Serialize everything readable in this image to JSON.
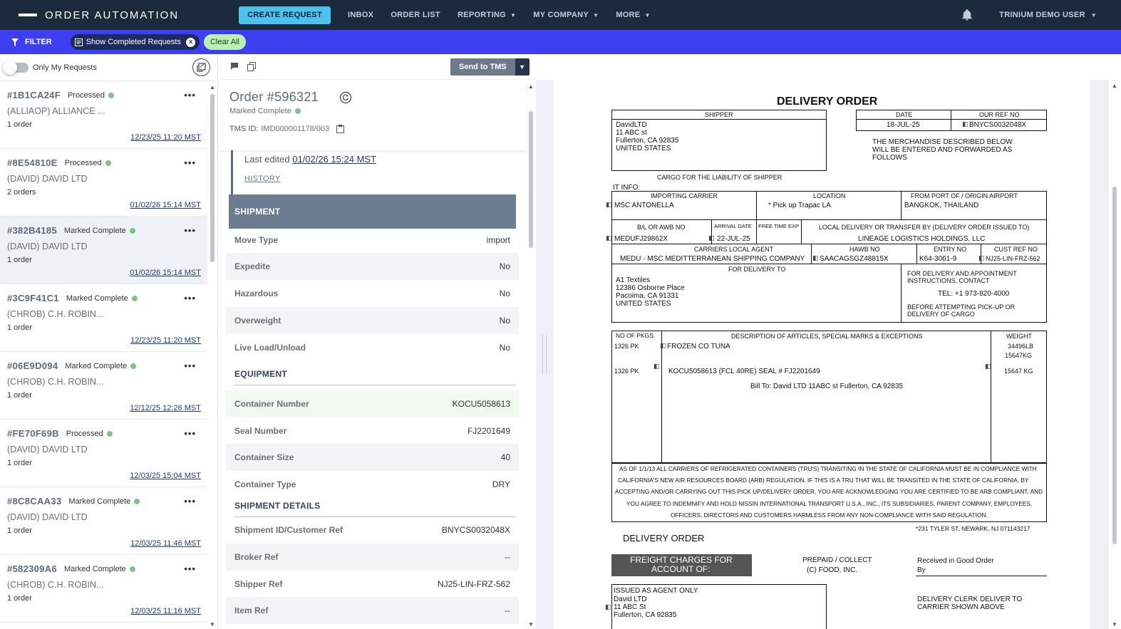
{
  "nav": {
    "logo_text": "ORDER AUTOMATION",
    "create_request": "CREATE REQUEST",
    "inbox": "INBOX",
    "order_list": "ORDER LIST",
    "reporting": "REPORTING",
    "my_company": "MY COMPANY",
    "more": "MORE",
    "user": "TRINIUM DEMO USER"
  },
  "filterbar": {
    "filter_label": "FILTER",
    "chip_label": "Show Completed Requests",
    "clear_all": "Clear All"
  },
  "sidebar": {
    "toggle_label": "Only My Requests",
    "requests": [
      {
        "id": "#1B1CA24F",
        "status": "Processed",
        "name": "(ALLIAOP) ALLIANCE ...",
        "count": "1 order",
        "date": "12/23/25 11:20 MST"
      },
      {
        "id": "#8E54810E",
        "status": "Processed",
        "name": "(DAVID) DAVID LTD",
        "count": "2 orders",
        "date": "01/02/26 15:14 MST"
      },
      {
        "id": "#382B4185",
        "status": "Marked Complete",
        "name": "(DAVID) DAVID LTD",
        "count": "1 order",
        "date": "01/02/26 15:14 MST"
      },
      {
        "id": "#3C9F41C1",
        "status": "Marked Complete",
        "name": "(CHROB) C.H. ROBIN...",
        "count": "1 order",
        "date": "12/23/25 11:20 MST"
      },
      {
        "id": "#06E9D094",
        "status": "Marked Complete",
        "name": "(CHROB) C.H. ROBIN...",
        "count": "1 order",
        "date": "12/12/25 12:26 MST"
      },
      {
        "id": "#FE70F69B",
        "status": "Processed",
        "name": "(DAVID) DAVID LTD",
        "count": "1 order",
        "date": "12/03/25 15:04 MST"
      },
      {
        "id": "#8C8CAA33",
        "status": "Marked Complete",
        "name": "(DAVID) DAVID LTD",
        "count": "1 order",
        "date": "12/03/25 11:46 MST"
      },
      {
        "id": "#582309A6",
        "status": "Marked Complete",
        "name": "(CHROB) C.H. ROBIN...",
        "count": "1 order",
        "date": "12/03/25 11:16 MST"
      }
    ]
  },
  "order": {
    "send_to_tms": "Send to TMS",
    "title": "Order #596321",
    "status": "Marked Complete",
    "tms_label": "TMS ID:",
    "tms_value": "IMD000001178/003",
    "last_edited_label": "Last edited",
    "last_edited_value": "01/02/26 15:24 MST",
    "history": "HISTORY",
    "shipment_header": "SHIPMENT",
    "shipment_rows": [
      {
        "k": "Move Type",
        "v": "import"
      },
      {
        "k": "Expedite",
        "v": "No"
      },
      {
        "k": "Hazardous",
        "v": "No"
      },
      {
        "k": "Overweight",
        "v": "No"
      },
      {
        "k": "Live Load/Unload",
        "v": "No"
      }
    ],
    "equipment_header": "EQUIPMENT",
    "equipment_rows": [
      {
        "k": "Container Number",
        "v": "KOCU5058613"
      },
      {
        "k": "Seal Number",
        "v": "FJ2201649"
      },
      {
        "k": "Container Size",
        "v": "40"
      },
      {
        "k": "Container Type",
        "v": "DRY"
      }
    ],
    "details_header": "SHIPMENT DETAILS",
    "details_rows": [
      {
        "k": "Shipment ID/Customer Ref",
        "v": "BNYCS0032048X"
      },
      {
        "k": "Broker Ref",
        "v": "--"
      },
      {
        "k": "Shipper Ref",
        "v": "NJ25-LIN-FRZ-562"
      },
      {
        "k": "Item Ref",
        "v": "--"
      }
    ]
  },
  "doc": {
    "title": "DELIVERY ORDER",
    "shipper_label": "SHIPPER",
    "shipper_lines": [
      "DavidLTD",
      "11 ABC st",
      "Fullerton, CA 92835",
      "UNITED STATES"
    ],
    "date_label": "DATE",
    "date_value": "18-JUL-25",
    "ourref_label": "OUR REF NO",
    "ourref_value": "BNYCS0032048X",
    "merch_lines": [
      "THE MERCHANDISE DESCRIBED BELOW",
      "WILL BE ENTERED AND FORWARDED AS",
      "FOLLOWS"
    ],
    "cargo_liability": "CARGO FOR THE LIABILITY OF SHIPPER",
    "it_info": "IT INFO:",
    "importing_carrier_label": "IMPORTING CARRIER",
    "importing_carrier_value": "MSC ANTONELLA",
    "location_label": "LOCATION",
    "location_value": "* Pick up  Trapac LA",
    "origin_label": "FROM PORT OF / ORIGIN AIRPORT",
    "origin_value": "BANGKOK, THAILAND",
    "bl_label": "B/L OR AWB NO",
    "bl_value": "MEDUFJ29862X",
    "arrival_label": "ARRIVAL DATE",
    "arrival_value": "22-JUL-25",
    "freetime_label": "FREE TIME EXP",
    "local_delivery_label": "LOCAL DELIVERY OR TRANSFER BY (DELIVERY ORDER ISSUED TO)",
    "local_delivery_value": "LINEAGE LOGISTICS HOLDINGS, LLC",
    "carriers_agent_label": "CARRIERS LOCAL AGENT",
    "carriers_agent_value": "MEDU - MSC MEDITTERRANEAN SHIPPING COMPANY",
    "hawb_label": "HAWB NO",
    "hawb_value": "SAACAGSGZ48815X",
    "entry_label": "ENTRY NO",
    "entry_value": "K64-3061-9",
    "custref_label": "CUST REF NO",
    "custref_value": "NJ25-LIN-FRZ-562",
    "for_delivery_label": "FOR DELIVERY TO",
    "for_delivery_lines": [
      "A1 Textiles",
      "12386 Osborne Place",
      "Pacoima, CA 91331",
      "UNITED STATES"
    ],
    "appt_lines": [
      "FOR DELIVERY AND APPOINTMENT",
      "INSTRUCTIONS, CONTACT"
    ],
    "tel": "TEL: +1 973-820-4000",
    "before_lines": [
      "BEFORE ATTEMPTING PICK-UP OR",
      "DELIVERY OF CARGO"
    ],
    "pkgs_label": "NO OF PKGS.",
    "desc_label": "DESCRIPTION OF ARTICLES, SPECIAL MARKS & EXCEPTIONS",
    "weight_label": "WEIGHT",
    "pkg1": "1326 PK",
    "desc1": "FROZEN CO TUNA",
    "wt1a": "34496LB",
    "wt1b": "15647KG",
    "pkg2": "1326 PK",
    "desc2": "KOCU5058613  (FCL 40RE) SEAL # FJ2201649",
    "wt2": "15647 KG",
    "bill_to": "Bill To: David LTD 11ABC st Fullerton, CA 92835",
    "legal_lines": [
      "AS OF 1/1/13 ALL CARRIERS OF REFRIGERATED CONTAINERS (TRU'S) TRANSITING IN THE STATE OF CALIFORNIA MUST BE IN COMPLIANCE WITH",
      "CALIFORNIA'S NEW AIR RESOURCES BOARD (ARB) REGULATION.  IF THIS IS A TRU THAT WILL BE TRANSITED IN THE STATE OF CALIFORNIA, BY",
      "ACCEPTING AND/OR CARRYING OUT THIS PICK UP/DELIVERY ORDER, YOU ARE ACKNOWLEDGING YOU ARE CERTIFIED TO BE ARB COMPLIANT, AND",
      "YOU AGREE TO INDEMNIFY AND HOLD NISSIN INTERNATIONAL TRANSPORT U.S.A., INC., ITS SUBSIDIARIES, PARENT COMPANY, EMPLOYEES,",
      "OFFICERS, DIRECTORS AND CUSTOMERS HARMLESS FROM ANY NON-COMPLIANCE WITH SAID REGULATION."
    ],
    "address_footer": "*231 TYLER ST, NEWARK, NJ 071143217",
    "delivery_order_2": "DELIVERY ORDER",
    "freight_lines": [
      "FREIGHT CHARGES FOR",
      "ACCOUNT OF:"
    ],
    "prepaid": "PREPAID / COLLECT",
    "prepaid_value": "(C)  FOOD, INC.",
    "received": "Received in Good Order",
    "by": "By",
    "issued_lines": [
      "ISSUED AS AGENT ONLY",
      "David LTD",
      "11 ABC St",
      "Fullerton, CA 92835"
    ],
    "clerk_lines": [
      "DELIVERY CLERK DELIVER TO",
      "CARRIER SHOWN ABOVE"
    ]
  }
}
